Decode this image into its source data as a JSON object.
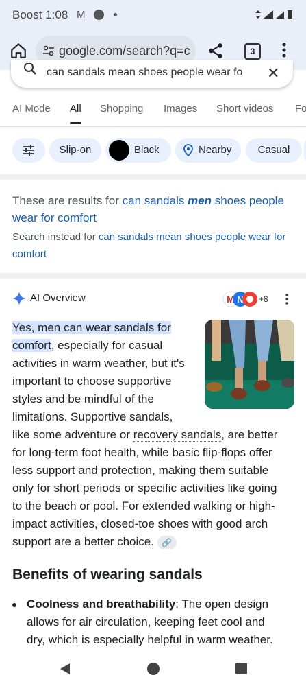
{
  "status_bar": {
    "carrier": "Boost",
    "time": "1:08"
  },
  "browser": {
    "url": "google.com/search?q=c",
    "tab_count": "3"
  },
  "search": {
    "query": "can sandals mean shoes people wear fo"
  },
  "nav_tabs": [
    "AI Mode",
    "All",
    "Shopping",
    "Images",
    "Short videos",
    "Fo"
  ],
  "chips": [
    "Slip-on",
    "Black",
    "Nearby",
    "Casual"
  ],
  "results_notice": {
    "prefix": "These are results for ",
    "link_a": "can sandals ",
    "link_bold": "men",
    "link_b": " shoes people wear for comfort",
    "instead_prefix": "Search instead for ",
    "instead_link": "can sandals mean shoes people wear for comfort"
  },
  "ai_overview": {
    "title": "AI Overview",
    "more_sources": "+8",
    "highlight": "Yes, men can wear sandals for comfort",
    "p_line1_tail": ", especially for casual",
    "p_lines": [
      "activities in warm weather, but it's",
      "important to choose supportive",
      "styles and be mindful of the",
      "limitations. Supportive sandals,"
    ],
    "p_like": "like some adventure or ",
    "p_link": "recovery sandals",
    "p_like_tail": ", are better",
    "p_full_lines": [
      "for long-term foot health, while basic flip-flops offer",
      "less support and protection, making them suitable",
      "only for short periods or specific activities like going",
      "to the beach or pool. For extended walking or high-",
      "impact activities, closed-toe shoes with good arch"
    ],
    "p_last": "support are a better choice."
  },
  "benefits": {
    "heading": "Benefits of wearing sandals",
    "bullet_bold": "Coolness and breathability",
    "bullet_text1": ": The open design",
    "bullet_lines": [
      "allows for air circulation, keeping feet cool and",
      "dry, which is especially helpful in warm weather."
    ]
  },
  "colors": {
    "accent": "#1a5fb4",
    "highlight": "#d3e3fd",
    "chip_bg": "#e8f0fe",
    "bar_bg": "#e9eef8"
  }
}
